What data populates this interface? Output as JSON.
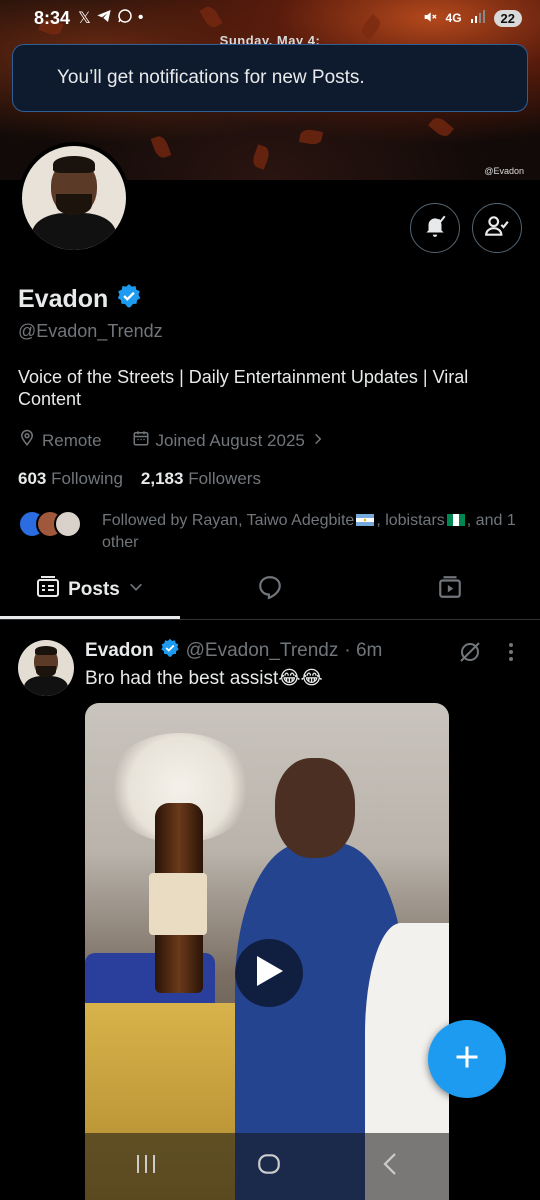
{
  "status_bar": {
    "time": "8:34",
    "network": "4G",
    "battery": "22"
  },
  "banner": {
    "date_text": "Sunday, May 4:",
    "watermark": "@Evadon"
  },
  "toast": {
    "message": "You’ll get notifications for new Posts."
  },
  "profile": {
    "name": "Evadon",
    "handle": "@Evadon_Trendz",
    "bio": "Voice of the Streets | Daily Entertainment Updates | Viral Content",
    "location": "Remote",
    "joined": "Joined August 2025",
    "following_count": "603",
    "following_label": "Following",
    "followers_count": "2,183",
    "followers_label": "Followers",
    "followed_by": "Followed by Rayan, Taiwo Adegbite",
    "followed_by_2": ", lobistars",
    "followed_by_3": ", and 1 other"
  },
  "tabs": {
    "posts_label": "Posts"
  },
  "post": {
    "name": "Evadon",
    "handle": "@Evadon_Trendz",
    "time": "· 6m",
    "text": "Bro had the best assist😂😂"
  },
  "colors": {
    "accent": "#1d9bf0",
    "verified": "#1d9bf0",
    "muted": "#71767b",
    "text": "#e7e9ea"
  }
}
